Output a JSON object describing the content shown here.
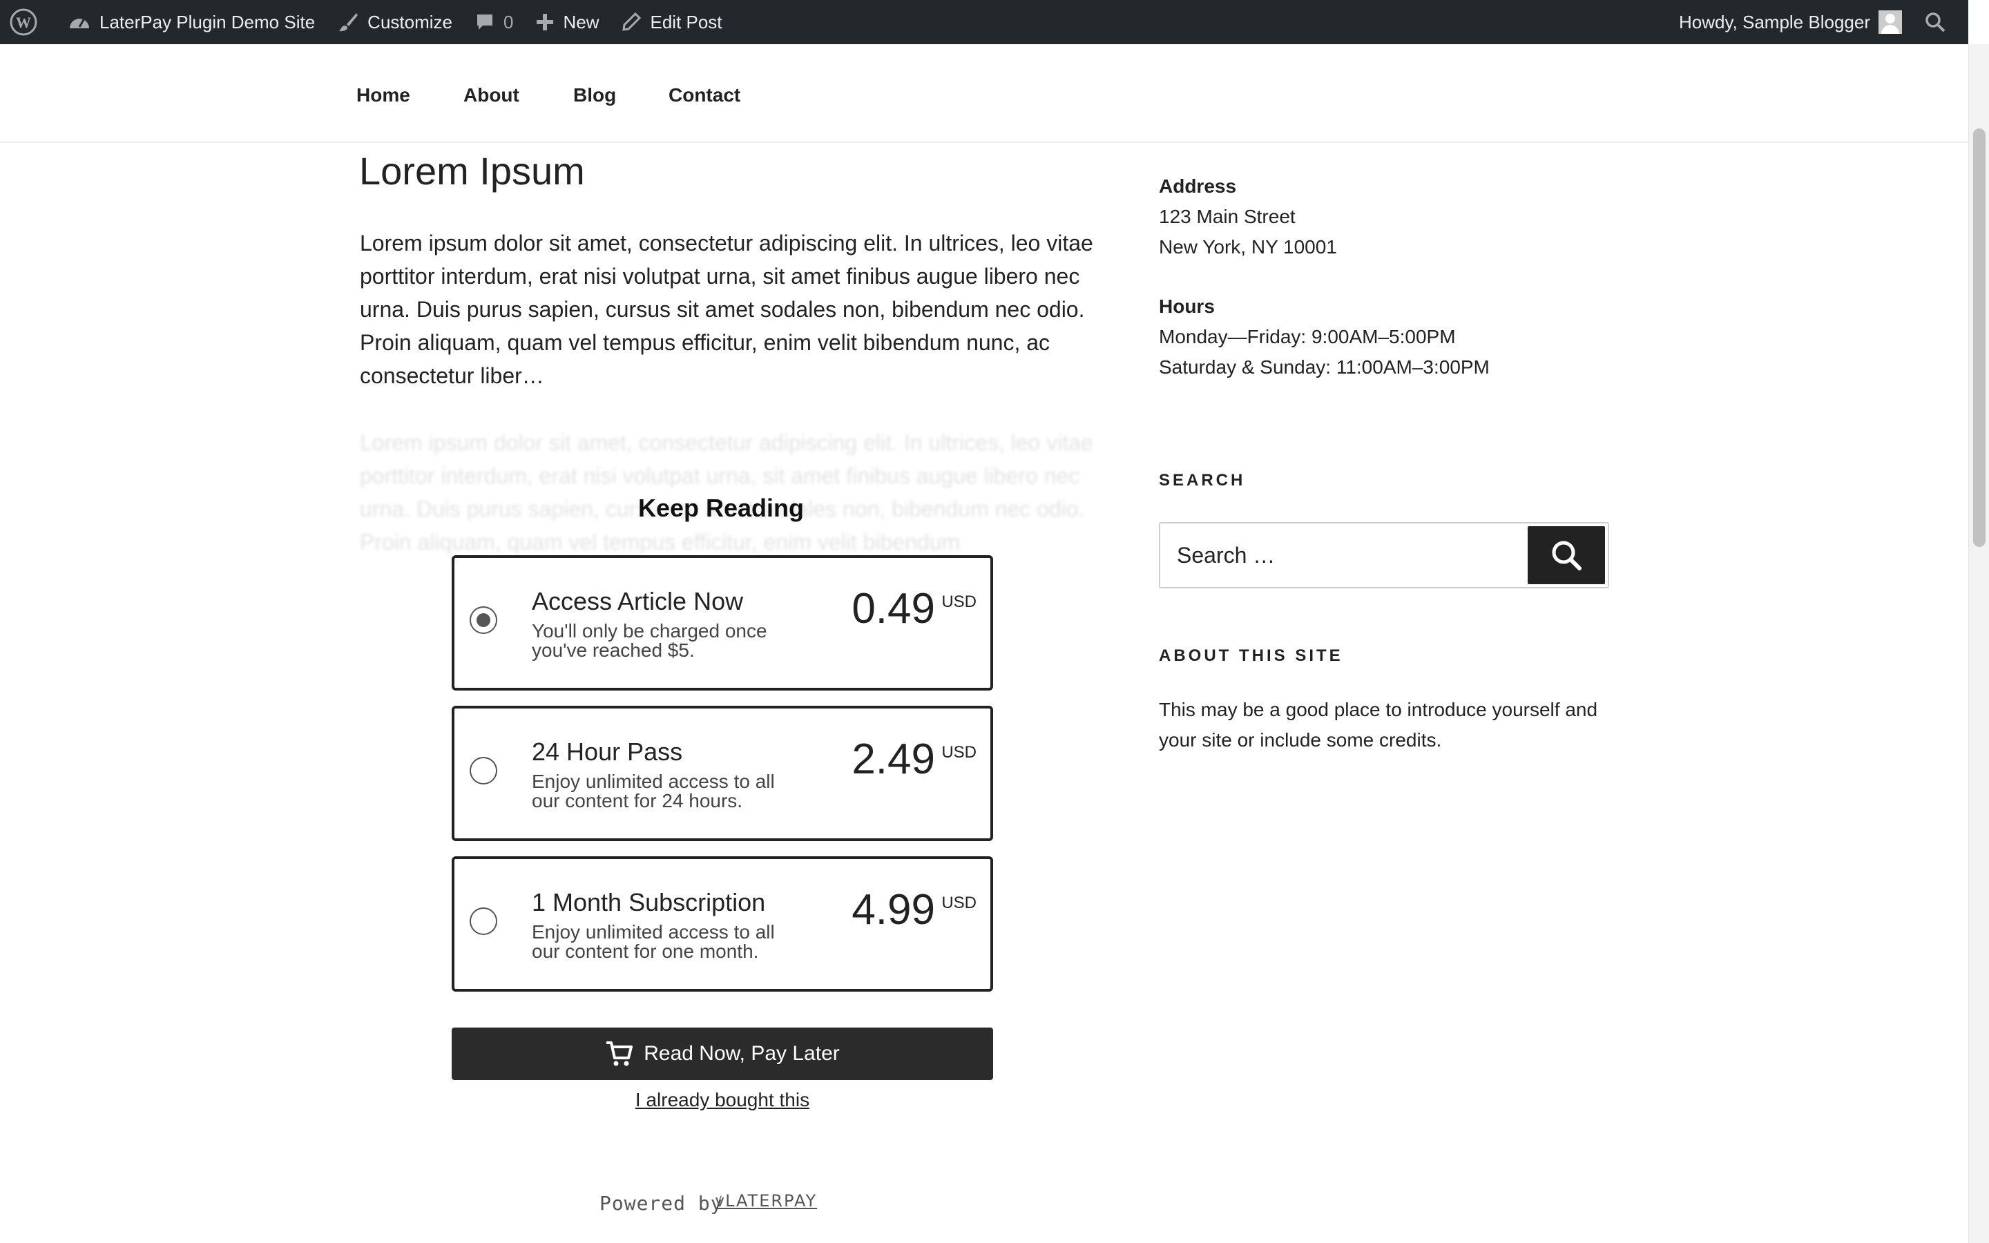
{
  "admin_bar": {
    "site_name": "LaterPay Plugin Demo Site",
    "customize": "Customize",
    "comments_count": "0",
    "new": "New",
    "edit_post": "Edit Post",
    "howdy": "Howdy, Sample Blogger"
  },
  "nav": {
    "items": [
      {
        "label": "Home"
      },
      {
        "label": "About"
      },
      {
        "label": "Blog"
      },
      {
        "label": "Contact"
      }
    ]
  },
  "post": {
    "title": "Lorem Ipsum",
    "excerpt": "Lorem ipsum dolor sit amet, consectetur adipiscing elit. In ultrices, leo vitae porttitor interdum, erat nisi volutpat urna, sit amet finibus augue libero nec urna. Duis purus sapien, cursus sit amet sodales non, bibendum nec odio. Proin aliquam, quam vel tempus efficitur, enim velit bibendum nunc, ac consectetur liber…",
    "blurred": "Lorem ipsum dolor sit amet, consectetur adipiscing elit. In ultrices, leo vitae porttitor interdum, erat nisi volutpat urna, sit amet finibus augue libero nec urna. Duis purus sapien, cursus sit amet sodales non, bibendum nec odio. Proin aliquam, quam vel tempus efficitur, enim velit bibendum"
  },
  "paywall": {
    "heading": "Keep Reading",
    "options": [
      {
        "title": "Access Article Now",
        "desc": "You'll only be charged once you've reached $5.",
        "price": "0.49",
        "currency": "USD",
        "selected": true
      },
      {
        "title": "24 Hour Pass",
        "desc": "Enjoy unlimited access to all our content for 24 hours.",
        "price": "2.49",
        "currency": "USD",
        "selected": false
      },
      {
        "title": "1 Month Subscription",
        "desc": "Enjoy unlimited access to all our content for one month.",
        "price": "4.99",
        "currency": "USD",
        "selected": false
      }
    ],
    "button_label": "Read Now, Pay Later",
    "already_bought": "I already bought this",
    "powered_by": "Powered by",
    "powered_logo": "ꝟLATERPAY"
  },
  "sidebar": {
    "address_heading": "Address",
    "address_line1": "123 Main Street",
    "address_line2": "New York, NY 10001",
    "hours_heading": "Hours",
    "hours_line1": "Monday—Friday: 9:00AM–5:00PM",
    "hours_line2": "Saturday & Sunday: 11:00AM–3:00PM",
    "search_heading": "SEARCH",
    "search_placeholder": "Search …",
    "about_heading": "ABOUT THIS SITE",
    "about_text": "This may be a good place to introduce yourself and your site or include some credits."
  },
  "icons": {
    "wordpress": "wordpress-logo-icon",
    "dashboard": "dashboard-icon",
    "customize": "paintbrush-icon",
    "comments": "comment-bubble-icon",
    "new": "plus-icon",
    "edit": "pencil-icon",
    "search": "search-icon",
    "cart": "cart-icon"
  }
}
